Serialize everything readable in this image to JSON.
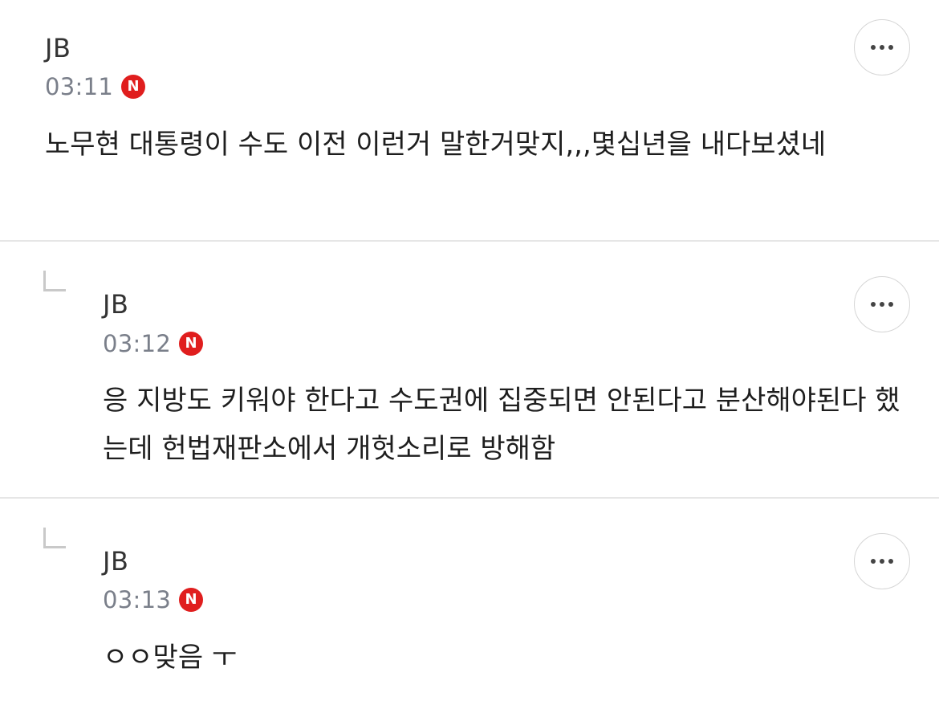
{
  "comments": [
    {
      "author": "JB",
      "time": "03:11",
      "badge": "N",
      "text": "노무현 대통령이 수도 이전 이런거 말한거맞지,,,몇십년을 내다보셨네",
      "is_reply": false
    },
    {
      "author": "JB",
      "time": "03:12",
      "badge": "N",
      "text": "응 지방도 키워야 한다고 수도권에 집중되면 안된다고 분산해야된다 했는데 헌법재판소에서 개헛소리로 방해함",
      "is_reply": true
    },
    {
      "author": "JB",
      "time": "03:13",
      "badge": "N",
      "text": "ㅇㅇ맞음 ㅜ",
      "is_reply": true
    }
  ],
  "icons": {
    "more": "more-horizontal-icon",
    "reply": "reply-arrow-icon",
    "new_badge": "new-badge-icon"
  },
  "colors": {
    "badge": "#e01e1e",
    "time": "#7a7f8a",
    "divider": "#e6e6e6"
  }
}
